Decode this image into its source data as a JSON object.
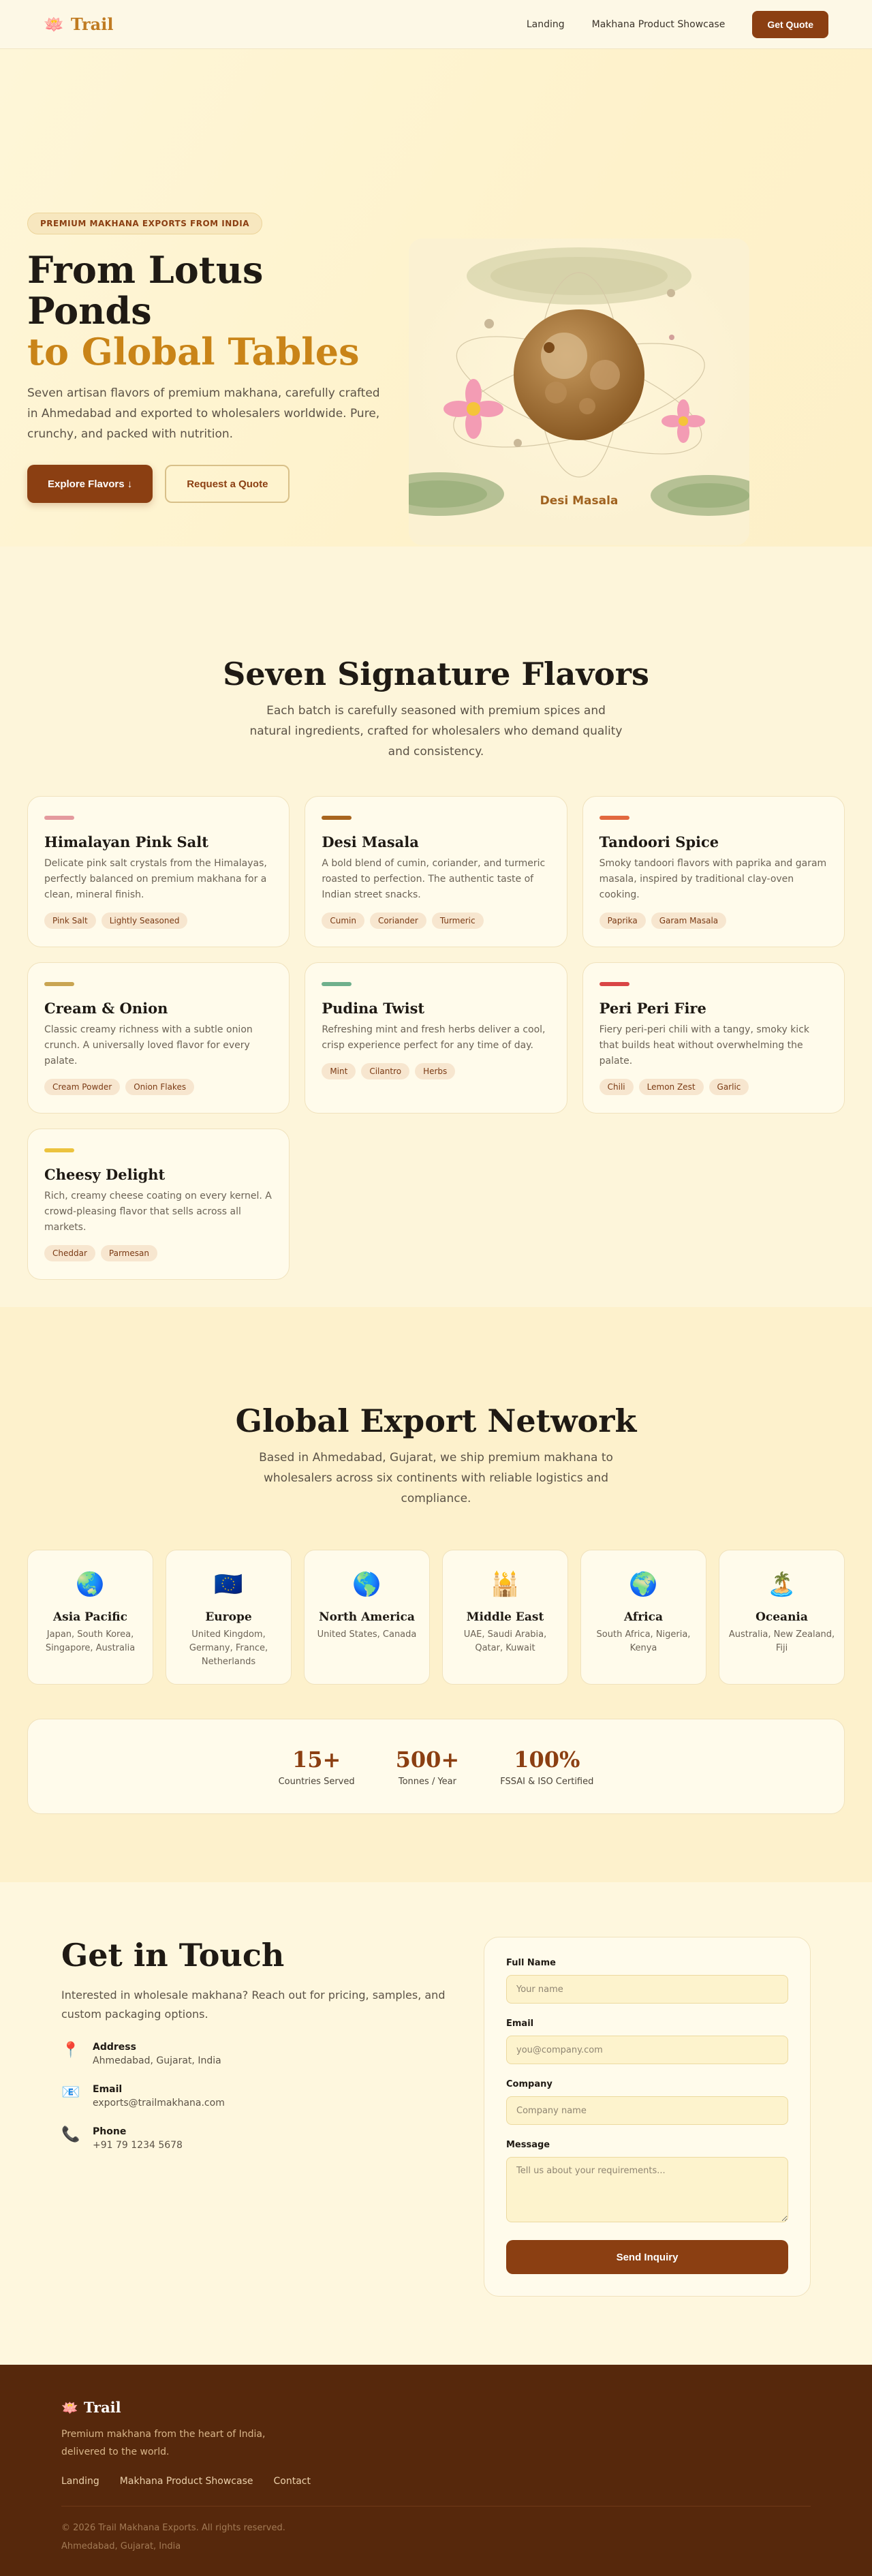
{
  "nav": {
    "brand": "Trail",
    "links": [
      "Landing",
      "Makhana Product Showcase"
    ],
    "cta": "Get Quote"
  },
  "hero": {
    "badge": "PREMIUM MAKHANA EXPORTS FROM INDIA",
    "title_line1": "From Lotus Ponds",
    "title_line2": "to Global Tables",
    "description": "Seven artisan flavors of premium makhana, carefully crafted in Ahmedabad and exported to wholesalers worldwide. Pure, crunchy, and packed with nutrition.",
    "primary_button": "Explore Flavors ↓",
    "secondary_button": "Request a Quote",
    "image_caption": "Desi Masala"
  },
  "flavors": {
    "title": "Seven Signature Flavors",
    "subtitle": "Each batch is carefully seasoned with premium spices and natural ingredients, crafted for wholesalers who demand quality and consistency.",
    "items": [
      {
        "name": "Himalayan Pink Salt",
        "color": "#e49a9e",
        "desc": "Delicate pink salt crystals from the Himalayas, perfectly balanced on premium makhana for a clean, mineral finish.",
        "tags": [
          "Pink Salt",
          "Lightly Seasoned"
        ]
      },
      {
        "name": "Desi Masala",
        "color": "#a8651f",
        "desc": "A bold blend of cumin, coriander, and turmeric roasted to perfection. The authentic taste of Indian street snacks.",
        "tags": [
          "Cumin",
          "Coriander",
          "Turmeric"
        ]
      },
      {
        "name": "Tandoori Spice",
        "color": "#e2683e",
        "desc": "Smoky tandoori flavors with paprika and garam masala, inspired by traditional clay-oven cooking.",
        "tags": [
          "Paprika",
          "Garam Masala"
        ]
      },
      {
        "name": "Cream & Onion",
        "color": "#c9a552",
        "desc": "Classic creamy richness with a subtle onion crunch. A universally loved flavor for every palate.",
        "tags": [
          "Cream Powder",
          "Onion Flakes"
        ]
      },
      {
        "name": "Pudina Twist",
        "color": "#6fb08c",
        "desc": "Refreshing mint and fresh herbs deliver a cool, crisp experience perfect for any time of day.",
        "tags": [
          "Mint",
          "Cilantro",
          "Herbs"
        ]
      },
      {
        "name": "Peri Peri Fire",
        "color": "#d94545",
        "desc": "Fiery peri-peri chili with a tangy, smoky kick that builds heat without overwhelming the palate.",
        "tags": [
          "Chili",
          "Lemon Zest",
          "Garlic"
        ]
      },
      {
        "name": "Cheesy Delight",
        "color": "#ecc33e",
        "desc": "Rich, creamy cheese coating on every kernel. A crowd-pleasing flavor that sells across all markets.",
        "tags": [
          "Cheddar",
          "Parmesan"
        ]
      }
    ]
  },
  "export": {
    "title": "Global Export Network",
    "subtitle": "Based in Ahmedabad, Gujarat, we ship premium makhana to wholesalers across six continents with reliable logistics and compliance.",
    "regions": [
      {
        "icon": "🌏",
        "name": "Asia Pacific",
        "countries": "Japan, South Korea, Singapore, Australia"
      },
      {
        "icon": "🇪🇺",
        "name": "Europe",
        "countries": "United Kingdom, Germany, France, Netherlands"
      },
      {
        "icon": "🌎",
        "name": "North America",
        "countries": "United States, Canada"
      },
      {
        "icon": "🕌",
        "name": "Middle East",
        "countries": "UAE, Saudi Arabia, Qatar, Kuwait"
      },
      {
        "icon": "🌍",
        "name": "Africa",
        "countries": "South Africa, Nigeria, Kenya"
      },
      {
        "icon": "🏝️",
        "name": "Oceania",
        "countries": "Australia, New Zealand, Fiji"
      }
    ],
    "stats": [
      {
        "value": "15+",
        "label": "Countries Served"
      },
      {
        "value": "500+",
        "label": "Tonnes / Year"
      },
      {
        "value": "100%",
        "label": "FSSAI & ISO Certified"
      }
    ]
  },
  "contact": {
    "title": "Get in Touch",
    "subtitle": "Interested in wholesale makhana? Reach out for pricing, samples, and custom packaging options.",
    "info": [
      {
        "icon": "📍",
        "label": "Address",
        "value": "Ahmedabad, Gujarat, India"
      },
      {
        "icon": "📧",
        "label": "Email",
        "value": "exports@trailmakhana.com"
      },
      {
        "icon": "📞",
        "label": "Phone",
        "value": "+91 79 1234 5678"
      }
    ],
    "form": {
      "name_label": "Full Name",
      "name_placeholder": "Your name",
      "email_label": "Email",
      "email_placeholder": "you@company.com",
      "company_label": "Company",
      "company_placeholder": "Company name",
      "message_label": "Message",
      "message_placeholder": "Tell us about your requirements...",
      "submit": "Send Inquiry"
    }
  },
  "footer": {
    "brand": "Trail",
    "description": "Premium makhana from the heart of India, delivered to the world.",
    "links": [
      "Landing",
      "Makhana Product Showcase",
      "Contact"
    ],
    "copyright": "© 2026 Trail Makhana Exports. All rights reserved.",
    "location": "Ahmedabad, Gujarat, India"
  }
}
